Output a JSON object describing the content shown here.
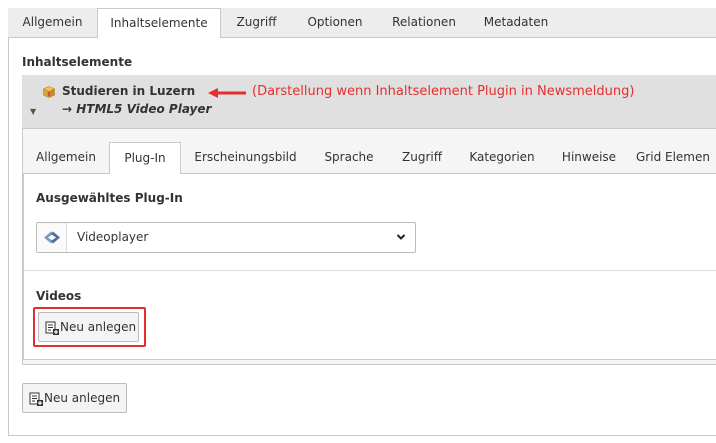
{
  "outer_tabs": [
    {
      "label": "Allgemein",
      "active": false
    },
    {
      "label": "Inhaltselemente",
      "active": true
    },
    {
      "label": "Zugriff",
      "active": false
    },
    {
      "label": "Optionen",
      "active": false
    },
    {
      "label": "Relationen",
      "active": false
    },
    {
      "label": "Metadaten",
      "active": false
    }
  ],
  "section": {
    "title": "Inhaltselemente"
  },
  "content_element": {
    "title": "Studieren in Luzern",
    "subtitle": "→ HTML5 Video Player",
    "annotation": "(Darstellung wenn Inhaltselement Plugin in Newsmeldung)",
    "toggle_icon": "caret-down-icon",
    "type_icon": "package-icon"
  },
  "inner_tabs": [
    {
      "label": "Allgemein",
      "active": false
    },
    {
      "label": "Plug-In",
      "active": true
    },
    {
      "label": "Erscheinungsbild",
      "active": false
    },
    {
      "label": "Sprache",
      "active": false
    },
    {
      "label": "Zugriff",
      "active": false
    },
    {
      "label": "Kategorien",
      "active": false
    },
    {
      "label": "Hinweise",
      "active": false
    },
    {
      "label": "Grid Elemen",
      "active": false
    }
  ],
  "plugin": {
    "label": "Ausgewähltes Plug-In",
    "selected": "Videoplayer",
    "icon": "plugin-icon"
  },
  "videos": {
    "label": "Videos",
    "new_button": "Neu anlegen"
  },
  "footer": {
    "new_button": "Neu anlegen"
  },
  "colors": {
    "annotation": "#e52e2e",
    "header_bg": "#e0e0e0",
    "tabbar_bg": "#ededed"
  }
}
